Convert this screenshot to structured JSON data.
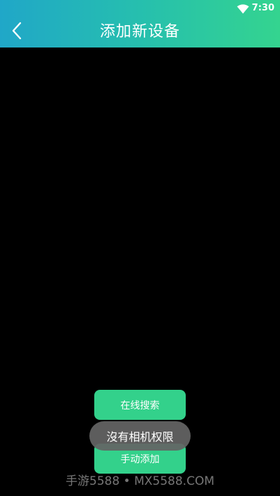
{
  "status_bar": {
    "time": "7:30",
    "wifi_icon": "wifi-icon"
  },
  "header": {
    "back_icon": "chevron-left-icon",
    "title": "添加新设备",
    "gradient": [
      "#20a7c8",
      "#34d48f"
    ]
  },
  "actions": {
    "online_search_label": "在线搜索",
    "manual_add_label": "手动添加",
    "button_color": "#33d18b"
  },
  "toast": {
    "message": "沒有相机权限"
  },
  "watermark": {
    "text": "手游5588 • MX5588.COM"
  }
}
